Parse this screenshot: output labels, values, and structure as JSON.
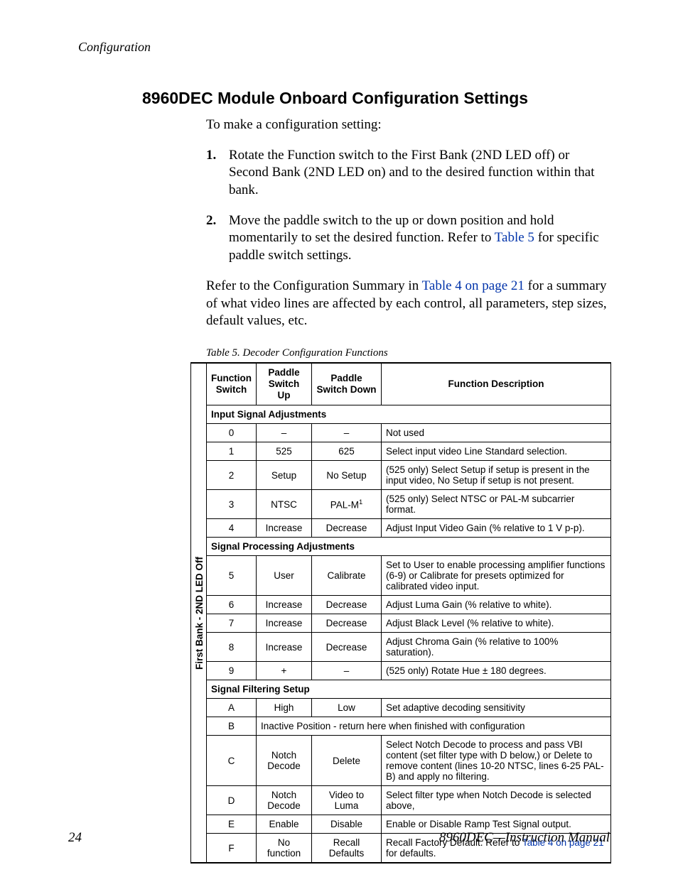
{
  "running_head": "Configuration",
  "heading": "8960DEC Module Onboard Configuration Settings",
  "intro": "To make a configuration setting:",
  "steps": {
    "s1": "Rotate the Function switch to the First Bank (2ND LED off) or Second Bank (2ND LED on) and to the desired function within that bank.",
    "s2_a": "Move the paddle switch to the up or down position and hold momentarily to set the desired function. Refer to ",
    "s2_link": "Table 5",
    "s2_b": " for specific paddle switch settings."
  },
  "refer_a": "Refer to the Configuration Summary in ",
  "refer_link": "Table 4 on page 21",
  "refer_b": " for a summary of what video lines are affected by each control, all parameters, step sizes, default values, etc.",
  "table_caption": "Table 5.  Decoder Configuration Functions",
  "headers": {
    "h1": "Function Switch",
    "h2": "Paddle Switch Up",
    "h3": "Paddle Switch Down",
    "h4": "Function Description"
  },
  "side_label": "First Bank - 2ND LED Off",
  "sections": {
    "sec1": "Input Signal Adjustments",
    "sec2": "Signal Processing Adjustments",
    "sec3": "Signal Filtering Setup"
  },
  "rows": {
    "r0": {
      "fn": "0",
      "up": "–",
      "dn": "–",
      "desc": "Not used"
    },
    "r1": {
      "fn": "1",
      "up": "525",
      "dn": "625",
      "desc": "Select input video Line Standard selection."
    },
    "r2": {
      "fn": "2",
      "up": "Setup",
      "dn": "No Setup",
      "desc": "(525 only) Select Setup if setup is present in the input video, No Setup if setup is not present."
    },
    "r3": {
      "fn": "3",
      "up": "NTSC",
      "dn_a": "PAL-M",
      "dn_sup": "1",
      "desc": "(525 only) Select NTSC or PAL-M subcarrier format."
    },
    "r4": {
      "fn": "4",
      "up": "Increase",
      "dn": "Decrease",
      "desc": "Adjust Input Video Gain (% relative to 1 V p-p)."
    },
    "r5": {
      "fn": "5",
      "up": "User",
      "dn": "Calibrate",
      "desc": "Set to User to enable processing amplifier functions (6-9) or Calibrate for presets optimized for calibrated video input."
    },
    "r6": {
      "fn": "6",
      "up": "Increase",
      "dn": "Decrease",
      "desc": "Adjust Luma Gain (% relative to white)."
    },
    "r7": {
      "fn": "7",
      "up": "Increase",
      "dn": "Decrease",
      "desc": "Adjust Black Level (% relative to white)."
    },
    "r8": {
      "fn": "8",
      "up": "Increase",
      "dn": "Decrease",
      "desc": "Adjust Chroma Gain (% relative to 100% saturation)."
    },
    "r9": {
      "fn": "9",
      "up": "+",
      "dn": "–",
      "desc": "(525 only) Rotate Hue ± 180 degrees."
    },
    "rA": {
      "fn": "A",
      "up": "High",
      "dn": "Low",
      "desc": "Set adaptive decoding sensitivity"
    },
    "rB": {
      "fn": "B",
      "span": "Inactive Position - return here when finished with configuration"
    },
    "rC": {
      "fn": "C",
      "up": "Notch Decode",
      "dn": "Delete",
      "desc": "Select Notch Decode to process and pass VBI content (set filter type with D below,) or Delete to remove content (lines 10-20 NTSC, lines 6-25 PAL-B) and apply no filtering."
    },
    "rD": {
      "fn": "D",
      "up": "Notch Decode",
      "dn": "Video to Luma",
      "desc": "Select filter type when Notch Decode is selected above,"
    },
    "rE": {
      "fn": "E",
      "up": "Enable",
      "dn": "Disable",
      "desc": "Enable or Disable Ramp Test Signal output."
    },
    "rF": {
      "fn": "F",
      "up": "No function",
      "dn": "Recall Defaults",
      "desc_a": "Recall Factory Default. Refer to ",
      "desc_link": "Table 4 on page 21",
      "desc_b": " for defaults."
    }
  },
  "footer": {
    "page": "24",
    "doc": "8960DEC—Instruction Manual"
  }
}
